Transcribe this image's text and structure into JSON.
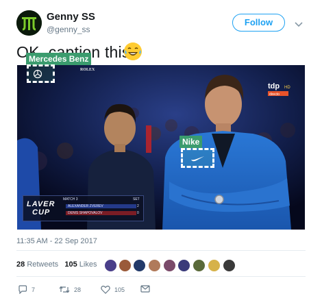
{
  "author": {
    "display_name": "Genny SS",
    "handle": "@genny_ss"
  },
  "follow_label": "Follow",
  "tweet": {
    "text": "OK, caption this"
  },
  "tags": [
    {
      "label": "Mercedes Benz"
    },
    {
      "label": "Nike"
    }
  ],
  "overlay": {
    "rolex": "ROLEX",
    "broadcaster": "tdp",
    "broadcaster_sub": "HD",
    "broadcaster_live": "directo",
    "scorebox_logo_line1": "LAVER",
    "scorebox_logo_line2": "CUP",
    "match_label": "MATCH 3",
    "set_header": "SET",
    "player1": "ALEXANDER ZVEREV",
    "player1_score": "2",
    "player2": "DENIS SHAPOVALOV",
    "player2_score": "0"
  },
  "timestamp": "11:35 AM - 22 Sep 2017",
  "stats": {
    "retweets_count": "28",
    "retweets_label": "Retweets",
    "likes_count": "105",
    "likes_label": "Likes"
  },
  "actions": {
    "replies": "7",
    "retweets": "28",
    "likes": "105"
  },
  "colors": {
    "accent": "#1da1f2",
    "tag_green": "#3b9c6e",
    "muted_text": "#657786"
  },
  "icons": {
    "reply": "reply-icon",
    "retweet": "retweet-icon",
    "like": "heart-icon",
    "message": "envelope-icon",
    "more": "chevron-down-icon",
    "emoji": "laughing-tears-emoji"
  }
}
